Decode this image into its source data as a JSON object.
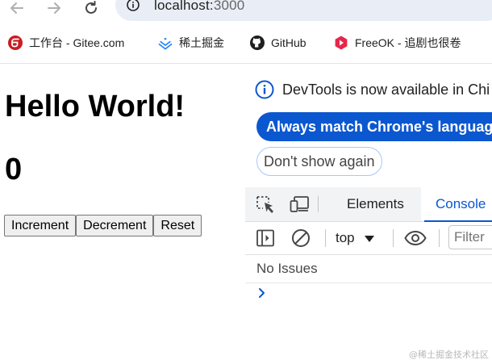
{
  "browser": {
    "url_host": "localhost:",
    "url_port": "3000",
    "bookmarks": [
      {
        "label": "工作台 - Gitee.com",
        "icon": "gitee-icon",
        "color": "#c71d23"
      },
      {
        "label": "稀土掘金",
        "icon": "juejin-icon",
        "color": "#1e80ff"
      },
      {
        "label": "GitHub",
        "icon": "github-icon",
        "color": "#1f1f1f"
      },
      {
        "label": "FreeOK - 追剧也很卷",
        "icon": "freeok-icon",
        "color": "#e8254b"
      }
    ]
  },
  "page": {
    "heading": "Hello World!",
    "count": "0",
    "buttons": {
      "increment": "Increment",
      "decrement": "Decrement",
      "reset": "Reset"
    }
  },
  "devtools": {
    "notice": "DevTools is now available in Chi",
    "primary_button": "Always match Chrome's language",
    "secondary_button": "Don't show again",
    "tabs": [
      "Elements",
      "Console"
    ],
    "active_tab": "Console",
    "accent_color": "#0b57d0",
    "context": "top",
    "filter_placeholder": "Filter",
    "issues": "No Issues"
  },
  "watermark": "@稀土掘金技术社区"
}
